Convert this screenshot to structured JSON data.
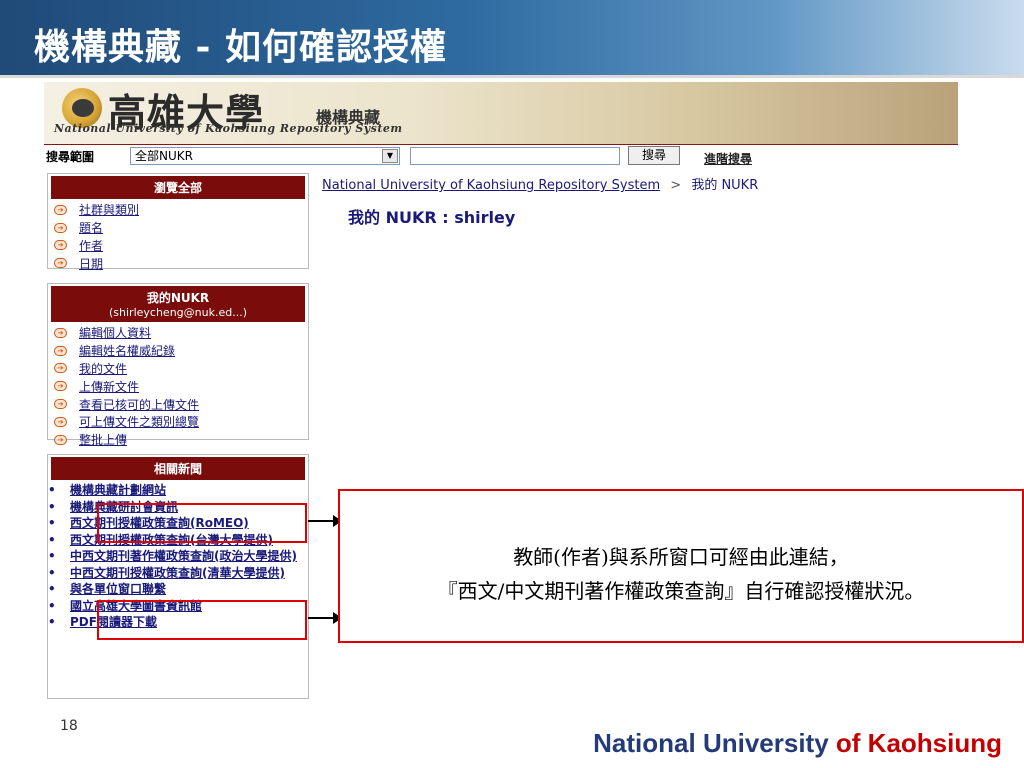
{
  "slide": {
    "title": "機構典藏 - 如何確認授權",
    "page_number": "18",
    "footer_main": "National University",
    "footer_accent": "of Kaohsiung"
  },
  "site": {
    "university_name": "高雄大學",
    "repository_name": "機構典藏",
    "english_name": "National University of Kaohsiung Repository System"
  },
  "search": {
    "scope_label": "搜尋範圍",
    "scope_value": "全部NUKR",
    "button_label": "搜尋",
    "advanced_label": "進階搜尋"
  },
  "browse": {
    "heading": "瀏覽全部",
    "items": [
      "社群與類別",
      "題名",
      "作者",
      "日期"
    ]
  },
  "my_nukr": {
    "heading": "我的NUKR",
    "email": "(shirleycheng@nuk.ed...)",
    "items": [
      "編輯個人資料",
      "編輯姓名權威紀錄",
      "我的文件",
      "上傳新文件",
      "查看已核可的上傳文件",
      "可上傳文件之類別總覽",
      "整批上傳"
    ]
  },
  "news": {
    "heading": "相關新聞",
    "items": [
      "機構典藏計劃網站",
      "機構典藏研討會資訊",
      "西文期刊授權政策查詢(RoMEO)",
      "西文期刊授權政策查詢(台灣大學提供)",
      "中西文期刊著作權政策查詢(政治大學提供)",
      "中西文期刊授權政策查詢(清華大學提供)",
      "與各單位窗口聯繫",
      "國立高雄大學圖書資訊館",
      "PDF閱讀器下載"
    ]
  },
  "main": {
    "breadcrumb_link": "National University of Kaohsiung Repository System",
    "breadcrumb_sep": ">",
    "breadcrumb_current": "我的 NUKR",
    "heading": "我的 NUKR : shirley"
  },
  "callout": {
    "line1": "教師(作者)與系所窗口可經由此連結，",
    "line2": "『西文/中文期刊著作權政策查詢』自行確認授權狀況。"
  },
  "colors": {
    "panel_header": "#7a0c0c",
    "link": "#1a1a7a",
    "annotation_red": "#e00000",
    "title_bar": "#2e6aa0"
  }
}
